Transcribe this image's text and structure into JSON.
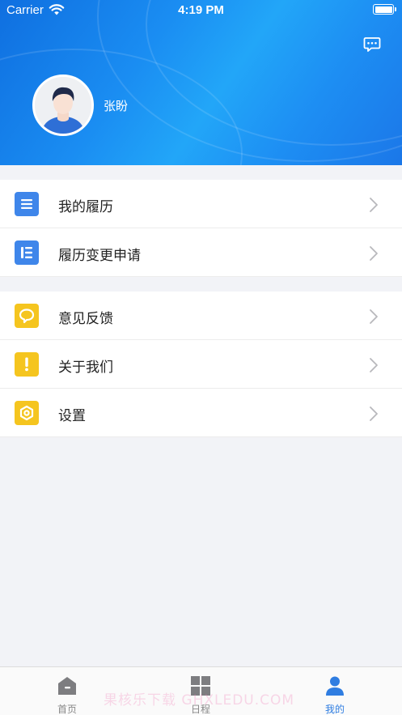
{
  "status_bar": {
    "carrier": "Carrier",
    "time": "4:19 PM"
  },
  "header": {
    "user_name": "张盼",
    "message_icon": "message-icon",
    "avatar": "avatar"
  },
  "colors": {
    "header_gradient": [
      "#0f6fe0",
      "#22a6f8",
      "#1b77e8"
    ],
    "icon_blue": "#3f86ea",
    "icon_yellow": "#f5c51f",
    "tab_active": "#2f7de1",
    "tab_inactive": "#888888",
    "background": "#f2f3f7"
  },
  "menu": {
    "group1": [
      {
        "label": "我的履历",
        "icon": "list-icon",
        "color": "blue"
      },
      {
        "label": "履历变更申请",
        "icon": "change-list-icon",
        "color": "blue"
      }
    ],
    "group2": [
      {
        "label": "意见反馈",
        "icon": "feedback-icon",
        "color": "yellow"
      },
      {
        "label": "关于我们",
        "icon": "exclamation-icon",
        "color": "yellow"
      },
      {
        "label": "设置",
        "icon": "settings-icon",
        "color": "yellow"
      }
    ]
  },
  "tab_bar": {
    "tabs": [
      {
        "label": "首页",
        "icon": "home-icon",
        "active": false
      },
      {
        "label": "日程",
        "icon": "grid-icon",
        "active": false
      },
      {
        "label": "我的",
        "icon": "person-icon",
        "active": true
      }
    ]
  },
  "watermark": "果核乐下载 GHXLEDU.COM"
}
